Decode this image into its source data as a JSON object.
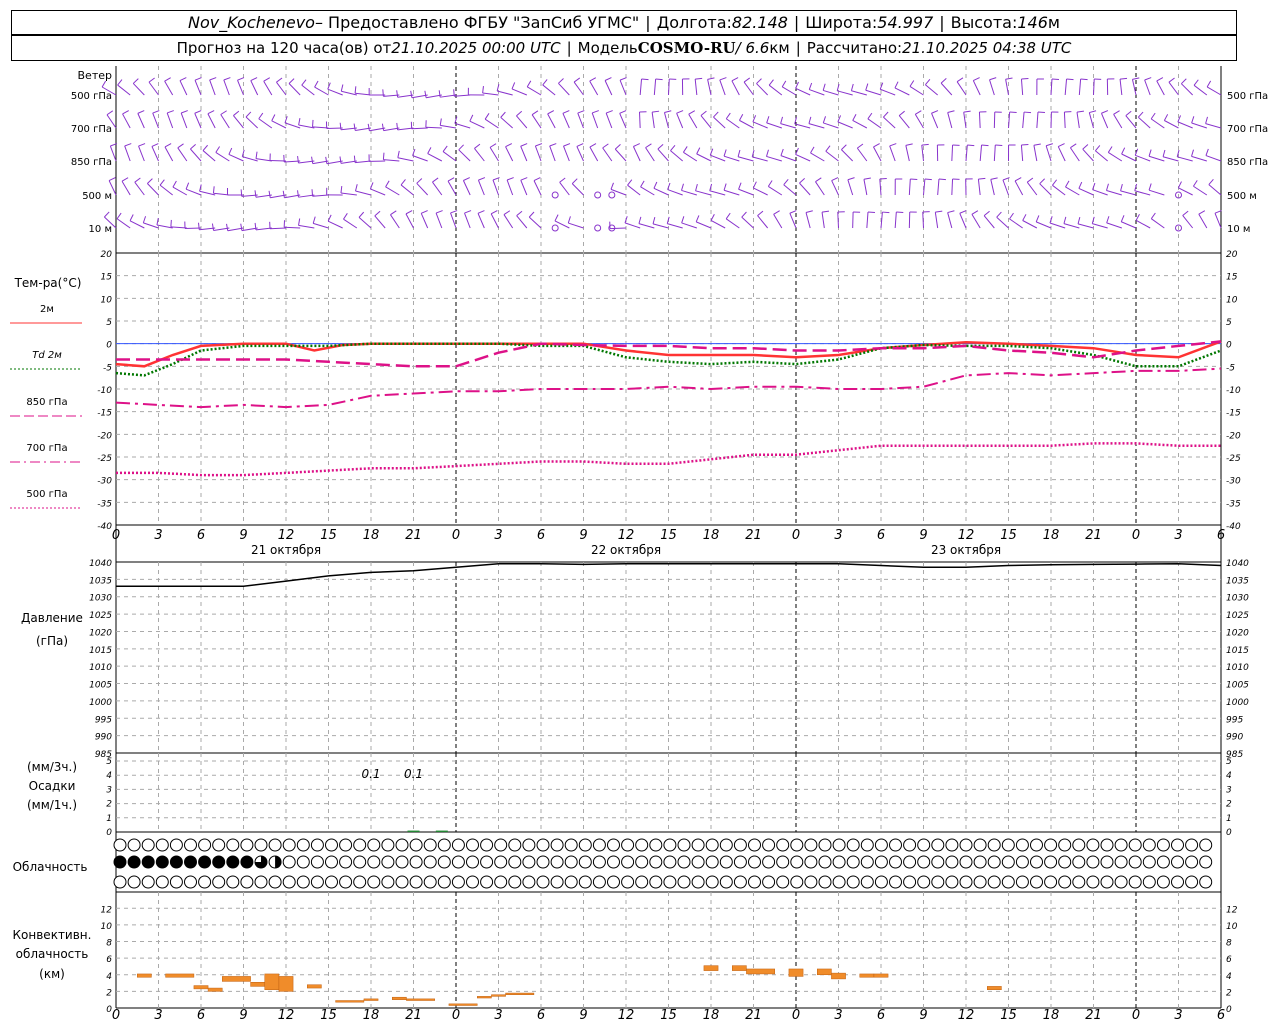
{
  "header": {
    "station": "Nov_Kochenevo",
    "provider": " – Предоставлено ФГБУ \"ЗапСиб УГМС\"",
    "lon_label": "Долгота: ",
    "lon": "82.148",
    "lat_label": "Широта: ",
    "lat": "54.997",
    "alt_label": "Высота: ",
    "alt": "146",
    "alt_unit": "м",
    "forecast_label": "Прогноз на 120 часа(ов) от ",
    "forecast_from": "21.10.2025 00:00 UTC",
    "model_label": "Модель ",
    "model": "COSMO-RU",
    "model_res": " / 6.6",
    "model_res_unit": "км",
    "calc_label": "Рассчитано: ",
    "calc_time": "21.10.2025 04:38 UTC"
  },
  "panels": {
    "wind": {
      "title": "Ветер",
      "levels": [
        "500 гПа",
        "700 гПа",
        "850 гПа",
        "500 м",
        "10  м"
      ]
    },
    "temperature": {
      "title": "Тем-ра(°С)",
      "legend": [
        {
          "label": "2м",
          "color": "#ff3333",
          "dash": "solid"
        },
        {
          "label": "Td  2м",
          "color": "#007700",
          "dash": "dotted"
        },
        {
          "label": "850 гПа",
          "color": "#dd1188",
          "dash": "dashed"
        },
        {
          "label": "700 гПа",
          "color": "#dd1188",
          "dash": "dashdot"
        },
        {
          "label": "500 гПа",
          "color": "#dd1188",
          "dash": "dotted"
        }
      ],
      "yticks": [
        20,
        15,
        10,
        5,
        0,
        -5,
        -10,
        -15,
        -20,
        -25,
        -30,
        -35,
        -40
      ]
    },
    "pressure": {
      "title": "Давление",
      "unit": "(гПа)",
      "yticks": [
        1040,
        1035,
        1030,
        1025,
        1020,
        1015,
        1010,
        1005,
        1000,
        995,
        990,
        985
      ]
    },
    "precip": {
      "title_top": "(мм/3ч.)",
      "title": "Осадки",
      "title_bottom": "(мм/1ч.)",
      "yticks": [
        5,
        4,
        3,
        2,
        1,
        0
      ],
      "labels": [
        {
          "hour": 18,
          "text": "0.1"
        },
        {
          "hour": 21,
          "text": "0.1"
        }
      ]
    },
    "cloud": {
      "title": "Облачность"
    },
    "convective": {
      "title_1": "Конвективн.",
      "title_2": "облачность",
      "title_3": "(км)",
      "yticks": [
        12,
        10,
        8,
        6,
        4,
        2,
        0
      ]
    }
  },
  "x_tick_labels": [
    "0",
    "3",
    "6",
    "9",
    "12",
    "15",
    "18",
    "21",
    "0",
    "3",
    "6",
    "9",
    "12",
    "15",
    "18",
    "21",
    "0",
    "3",
    "6",
    "9",
    "12",
    "15",
    "18",
    "21",
    "0",
    "3",
    "6"
  ],
  "days": [
    {
      "hour": 12,
      "label": "21 октября"
    },
    {
      "hour": 36,
      "label": "22 октября"
    },
    {
      "hour": 60,
      "label": "23 октября"
    }
  ],
  "chart_data": [
    {
      "type": "line",
      "title": "Тем-ра(°С)",
      "x_unit": "hours from 21.10.2025 00:00 UTC",
      "xlim": [
        0,
        78
      ],
      "ylim": [
        -40,
        20
      ],
      "series": [
        {
          "name": "2м",
          "x": [
            0,
            2,
            4,
            6,
            9,
            12,
            14,
            16,
            18,
            21,
            24,
            27,
            30,
            33,
            36,
            39,
            42,
            45,
            48,
            51,
            54,
            57,
            60,
            63,
            66,
            69,
            72,
            75,
            78
          ],
          "values": [
            -4.5,
            -5,
            -2.5,
            -0.5,
            0,
            0,
            -1.5,
            -0.3,
            0,
            0,
            0,
            0,
            0,
            0,
            -1.5,
            -2.5,
            -2.5,
            -2.5,
            -3,
            -2.5,
            -1,
            -0.3,
            0.3,
            0,
            -0.5,
            -1,
            -2.5,
            -3,
            0.5
          ]
        },
        {
          "name": "Td  2м",
          "x": [
            0,
            2,
            4,
            6,
            9,
            12,
            15,
            18,
            21,
            24,
            27,
            30,
            33,
            36,
            39,
            42,
            45,
            48,
            51,
            54,
            57,
            60,
            63,
            66,
            69,
            72,
            75,
            78
          ],
          "values": [
            -6.5,
            -7,
            -4.5,
            -1.5,
            -0.5,
            -0.5,
            -0.5,
            0,
            0,
            0,
            0,
            -0.5,
            -0.5,
            -3,
            -4,
            -4.5,
            -4,
            -4.5,
            -3.5,
            -1,
            -0.3,
            -0.5,
            -0.5,
            -1,
            -2.5,
            -5,
            -5,
            -1.5
          ]
        },
        {
          "name": "850 гПа",
          "x": [
            0,
            3,
            6,
            9,
            12,
            15,
            18,
            21,
            24,
            27,
            30,
            33,
            36,
            39,
            42,
            45,
            48,
            51,
            54,
            57,
            60,
            63,
            66,
            69,
            72,
            75,
            78
          ],
          "values": [
            -3.5,
            -3.5,
            -3.5,
            -3.5,
            -3.5,
            -4,
            -4.5,
            -5,
            -5,
            -2,
            0,
            -0.3,
            -0.5,
            -0.5,
            -1,
            -1,
            -1.5,
            -1.5,
            -1,
            -1,
            -0.5,
            -1.5,
            -2,
            -3,
            -1.5,
            -0.5,
            0.5
          ]
        },
        {
          "name": "700 гПа",
          "x": [
            0,
            3,
            6,
            9,
            12,
            15,
            18,
            21,
            24,
            27,
            30,
            33,
            36,
            39,
            42,
            45,
            48,
            51,
            54,
            57,
            60,
            63,
            66,
            69,
            72,
            75,
            78
          ],
          "values": [
            -13,
            -13.5,
            -14,
            -13.5,
            -14,
            -13.5,
            -11.5,
            -11,
            -10.5,
            -10.5,
            -10,
            -10,
            -10,
            -9.5,
            -10,
            -9.5,
            -9.5,
            -10,
            -10,
            -9.5,
            -7,
            -6.5,
            -7,
            -6.5,
            -6,
            -6,
            -5.5
          ]
        },
        {
          "name": "500 гПа",
          "x": [
            0,
            3,
            6,
            9,
            12,
            15,
            18,
            21,
            24,
            27,
            30,
            33,
            36,
            39,
            42,
            45,
            48,
            51,
            54,
            57,
            60,
            63,
            66,
            69,
            72,
            75,
            78
          ],
          "values": [
            -28.5,
            -28.5,
            -29,
            -29,
            -28.5,
            -28,
            -27.5,
            -27.5,
            -27,
            -26.5,
            -26,
            -26,
            -26.5,
            -26.5,
            -25.5,
            -24.5,
            -24.5,
            -23.5,
            -22.5,
            -22.5,
            -22.5,
            -22.5,
            -22.5,
            -22,
            -22,
            -22.5,
            -22.5
          ]
        }
      ]
    },
    {
      "type": "line",
      "title": "Давление",
      "ylabel": "(гПа)",
      "xlim": [
        0,
        78
      ],
      "ylim": [
        985,
        1040
      ],
      "series": [
        {
          "x": [
            0,
            3,
            6,
            9,
            12,
            15,
            18,
            21,
            24,
            27,
            30,
            33,
            36,
            39,
            42,
            45,
            48,
            51,
            54,
            57,
            60,
            63,
            66,
            69,
            72,
            75,
            78
          ],
          "values": [
            1033,
            1033,
            1033,
            1033,
            1034.5,
            1036,
            1037,
            1037.5,
            1038.5,
            1039.5,
            1039.5,
            1039.3,
            1039.5,
            1039.5,
            1039.5,
            1039.5,
            1039.5,
            1039.5,
            1039,
            1038.5,
            1038.5,
            1039,
            1039.2,
            1039.3,
            1039.4,
            1039.5,
            1039
          ]
        }
      ]
    },
    {
      "type": "bar",
      "title": "Осадки",
      "ylabel": "(мм/1ч.)",
      "xlim": [
        0,
        78
      ],
      "ylim": [
        0,
        5
      ],
      "x": [
        21,
        23
      ],
      "values": [
        0.1,
        0.1
      ]
    },
    {
      "type": "bar",
      "title": "Конвективн. облачность",
      "ylabel": "(км)",
      "xlim": [
        0,
        78
      ],
      "ylim": [
        0,
        13
      ],
      "segments": [
        {
          "x0": 1.5,
          "x1": 2.5,
          "y0": 3.7,
          "y1": 4.1
        },
        {
          "x0": 3.5,
          "x1": 5.5,
          "y0": 3.7,
          "y1": 4.1
        },
        {
          "x0": 5.5,
          "x1": 6.5,
          "y0": 2.3,
          "y1": 2.7
        },
        {
          "x0": 6.5,
          "x1": 7.5,
          "y0": 2.0,
          "y1": 2.4
        },
        {
          "x0": 7.5,
          "x1": 9.5,
          "y0": 3.2,
          "y1": 3.8
        },
        {
          "x0": 9.5,
          "x1": 10.5,
          "y0": 2.6,
          "y1": 3.1
        },
        {
          "x0": 10.5,
          "x1": 11.5,
          "y0": 2.2,
          "y1": 4.1
        },
        {
          "x0": 11.5,
          "x1": 12.5,
          "y0": 2.0,
          "y1": 3.8
        },
        {
          "x0": 13.5,
          "x1": 14.5,
          "y0": 2.4,
          "y1": 2.8
        },
        {
          "x0": 15.5,
          "x1": 17.5,
          "y0": 0.7,
          "y1": 0.9
        },
        {
          "x0": 17.5,
          "x1": 18.5,
          "y0": 0.9,
          "y1": 1.1
        },
        {
          "x0": 19.5,
          "x1": 20.5,
          "y0": 1.0,
          "y1": 1.3
        },
        {
          "x0": 20.5,
          "x1": 22.5,
          "y0": 0.9,
          "y1": 1.1
        },
        {
          "x0": 23.5,
          "x1": 25.5,
          "y0": 0.3,
          "y1": 0.5
        },
        {
          "x0": 25.5,
          "x1": 26.5,
          "y0": 1.2,
          "y1": 1.4
        },
        {
          "x0": 26.5,
          "x1": 27.5,
          "y0": 1.4,
          "y1": 1.6
        },
        {
          "x0": 27.5,
          "x1": 29.5,
          "y0": 1.6,
          "y1": 1.8
        },
        {
          "x0": 41.5,
          "x1": 42.5,
          "y0": 4.5,
          "y1": 5.1
        },
        {
          "x0": 43.5,
          "x1": 44.5,
          "y0": 4.5,
          "y1": 5.1
        },
        {
          "x0": 44.5,
          "x1": 46.5,
          "y0": 4.1,
          "y1": 4.7
        },
        {
          "x0": 47.5,
          "x1": 48.5,
          "y0": 3.8,
          "y1": 4.7
        },
        {
          "x0": 49.5,
          "x1": 50.5,
          "y0": 4.0,
          "y1": 4.7
        },
        {
          "x0": 50.5,
          "x1": 51.5,
          "y0": 3.5,
          "y1": 4.2
        },
        {
          "x0": 52.5,
          "x1": 53.5,
          "y0": 3.7,
          "y1": 4.1
        },
        {
          "x0": 53.5,
          "x1": 54.5,
          "y0": 3.7,
          "y1": 4.1
        },
        {
          "x0": 61.5,
          "x1": 62.5,
          "y0": 2.2,
          "y1": 2.6
        }
      ]
    },
    {
      "type": "table",
      "title": "Облачность",
      "description_levels": [
        "upper",
        "middle",
        "lower"
      ],
      "cover_scale": "0=clear 1=quarter 2=half 3=three-quarter 4=overcast",
      "rows": [
        "000000000000000000000000000000000000000000000000000000000000000000000000000000",
        "444444444432000000000000000000000000000000000000000000000000000000000000000000",
        "000000000000000000000000000000000000000000000000000000000000000000000000000000"
      ]
    }
  ]
}
